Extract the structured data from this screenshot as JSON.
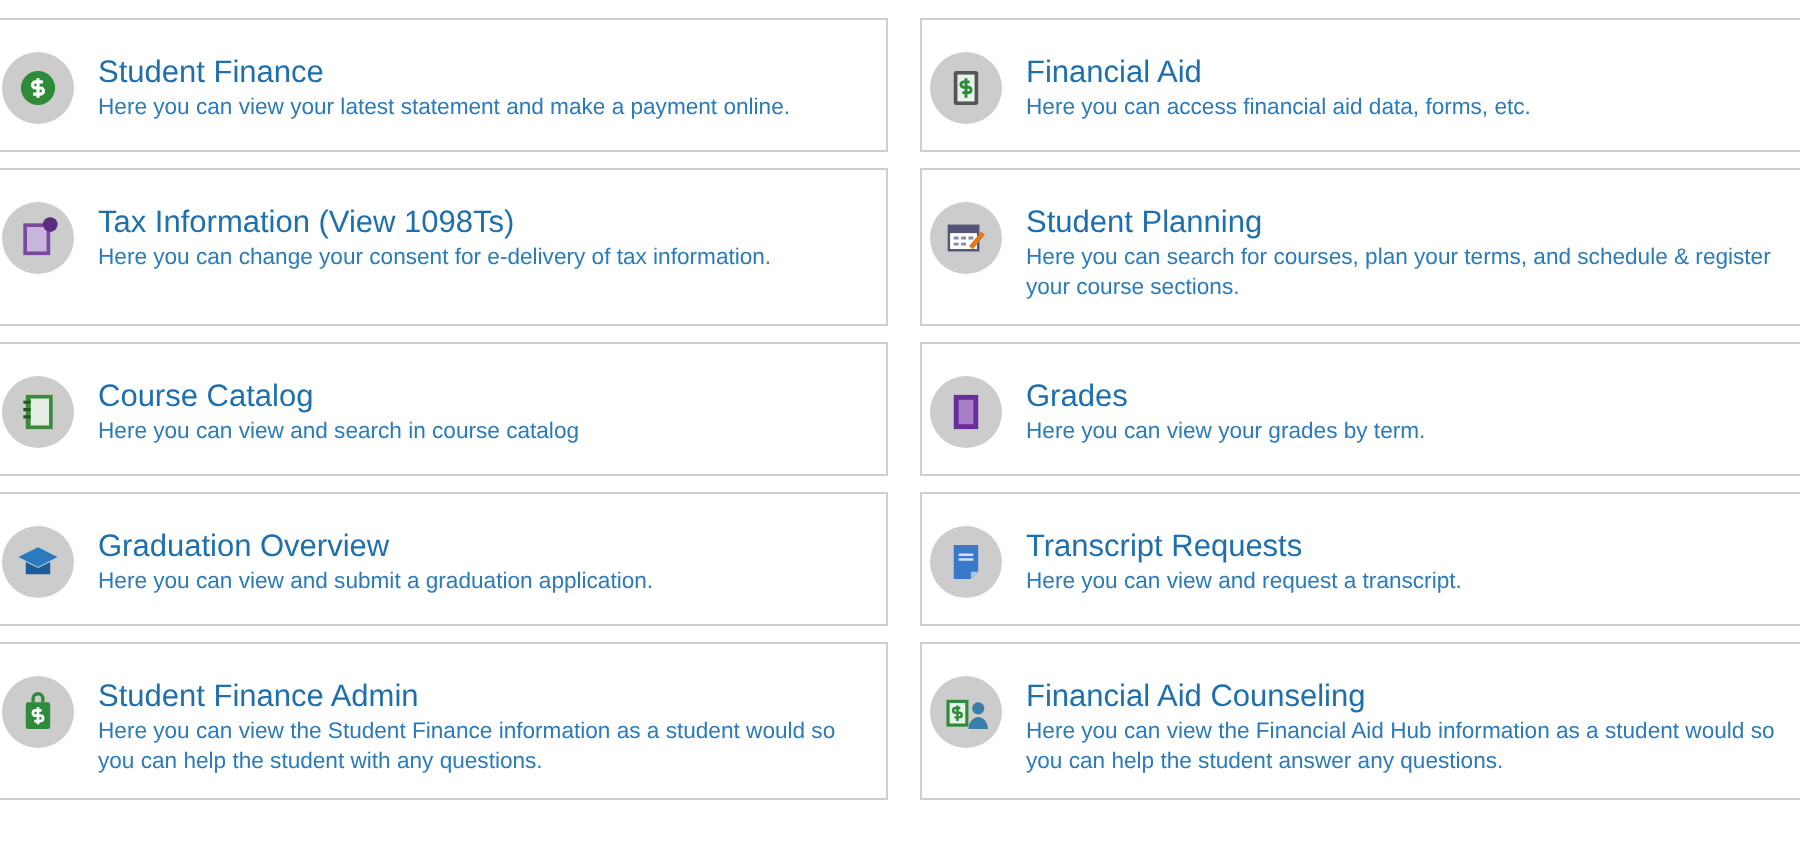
{
  "cards": [
    {
      "kind": "coin",
      "title": "Student Finance",
      "description": "Here you can view your latest statement and make a payment online."
    },
    {
      "kind": "money-doc",
      "title": "Financial Aid",
      "description": "Here you can access financial aid data, forms, etc."
    },
    {
      "kind": "tax",
      "title": "Tax Information (View 1098Ts)",
      "description": "Here you can change your consent for e-delivery of tax information."
    },
    {
      "kind": "calendar",
      "title": "Student Planning",
      "description": "Here you can search for courses, plan your terms, and schedule & register your course sections."
    },
    {
      "kind": "notebook",
      "title": "Course Catalog",
      "description": "Here you can view and search in course catalog"
    },
    {
      "kind": "gradebook",
      "title": "Grades",
      "description": "Here you can view your grades by term."
    },
    {
      "kind": "cap",
      "title": "Graduation Overview",
      "description": "Here you can view and submit a graduation application."
    },
    {
      "kind": "transcript",
      "title": "Transcript Requests",
      "description": "Here you can view and request a transcript."
    },
    {
      "kind": "bag",
      "title": "Student Finance Admin",
      "description": "Here you can view the Student Finance information as a student would so you can help the student with any questions."
    },
    {
      "kind": "counsel",
      "title": "Financial Aid Counseling",
      "description": "Here you can view the Financial Aid Hub information as a student would so you can help the student answer any questions."
    }
  ]
}
